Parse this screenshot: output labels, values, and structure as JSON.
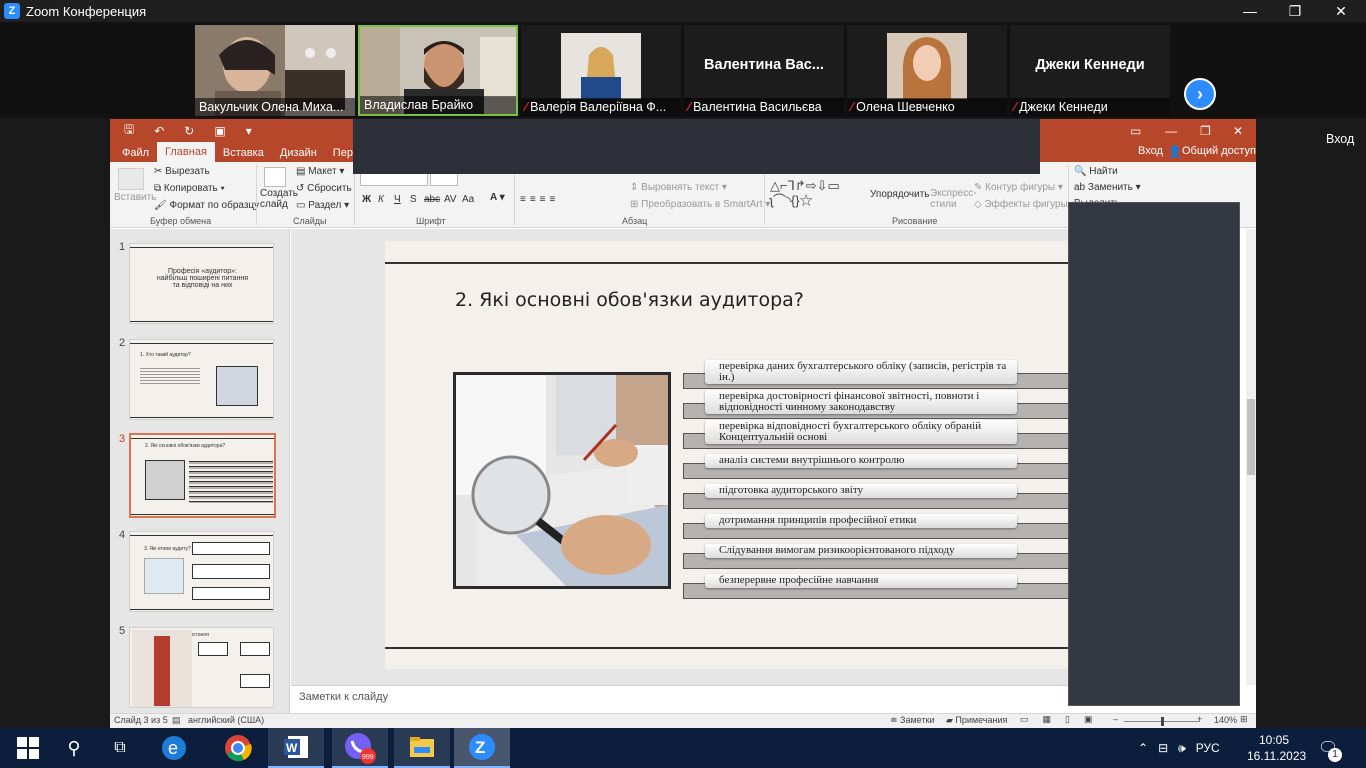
{
  "zoom": {
    "title": "Zoom Конференция",
    "win_controls": [
      "—",
      "❐",
      "✕"
    ],
    "participants": [
      {
        "name": "Вакульчик Олена Миха...",
        "video": true,
        "muted": false
      },
      {
        "name": "Владислав Брайко",
        "video": true,
        "muted": false,
        "active_speaker": true
      },
      {
        "name": "Валерія Валеріївна Ф...",
        "video": true,
        "muted": true
      },
      {
        "name": "Валентина Васильєва",
        "big_name": "Валентина  Вас...",
        "video": false,
        "muted": true
      },
      {
        "name": "Олена Шевченко",
        "video": true,
        "muted": true
      },
      {
        "name": "Джеки Кеннеди",
        "big_name": "Джеки Кеннеди",
        "video": false,
        "muted": true
      }
    ],
    "next_page_icon": "chevron-right-icon",
    "right_signin": "Вход"
  },
  "ppt": {
    "tabs": [
      "Файл",
      "Главная",
      "Вставка",
      "Дизайн",
      "Переходы"
    ],
    "active_tab": "Главная",
    "signin": "Вход",
    "share": "Общий доступ",
    "ribbon": {
      "paste": "Вставить",
      "cut": "Вырезать",
      "copy": "Копировать",
      "format_painter": "Формат по образцу",
      "clipboard_group": "Буфер обмена",
      "new_slide": "Создать слайд",
      "layout": "Макет",
      "reset": "Сбросить",
      "section": "Раздел",
      "slides_group": "Слайды",
      "font_group": "Шрифт",
      "align_text": "Выровнять текст",
      "smartart": "Преобразовать в SmartArt",
      "paragraph_group": "Абзац",
      "arrange": "Упорядочить",
      "quick_styles": "Экспресс-стили",
      "shape_outline": "Контур фигуры",
      "shape_effects": "Эффекты фигуры",
      "drawing_group": "Рисование",
      "find": "Найти",
      "replace": "Заменить",
      "partial_select": "Выделить",
      "font_bold": "Ж",
      "font_italic": "К",
      "font_underline": "Ч",
      "font_strike": "S",
      "font_shadow": "abc",
      "font_spacing": "AV",
      "font_case": "Aa"
    },
    "thumbnails": [
      {
        "num": "1",
        "title": "Професія «аудитор»:\nнайбільш поширені питання\nта відповіді на них"
      },
      {
        "num": "2",
        "title": "1. Хто такий аудитор?"
      },
      {
        "num": "3",
        "title": "2. Які основні обов'язки аудитора?",
        "selected": true
      },
      {
        "num": "4",
        "title": "3. Які етапи аудиту?"
      },
      {
        "num": "5",
        "title": "4. Кар'єрне зростання"
      }
    ],
    "slide": {
      "title": "2. Які основні обов'язки  аудитора?",
      "items": [
        "перевірка даних бухгалтерського обліку (записів, регістрів та ін.)",
        "перевірка достовірності фінансової звітності, повноти і відповідності чинному законодавству",
        "перевірка відповідності бухгалтерського обліку обраній Концептуальній основі",
        "аналіз системи внутрішнього контролю",
        "підготовка аудиторського звіту",
        "дотримання принципів професійної етики",
        "Слідування вимогам ризикоорієнтованого підходу",
        "безперервне професійне навчання"
      ]
    },
    "notes_placeholder": "Заметки к слайду",
    "status": {
      "slide_of": "Слайд 3 из 5",
      "language": "английский (США)",
      "notes": "Заметки",
      "comments": "Примечания",
      "zoom": "140%"
    }
  },
  "taskbar": {
    "viber_badge": "999",
    "lang": "РУС",
    "time": "10:05",
    "date": "16.11.2023",
    "notif_count": "1"
  }
}
